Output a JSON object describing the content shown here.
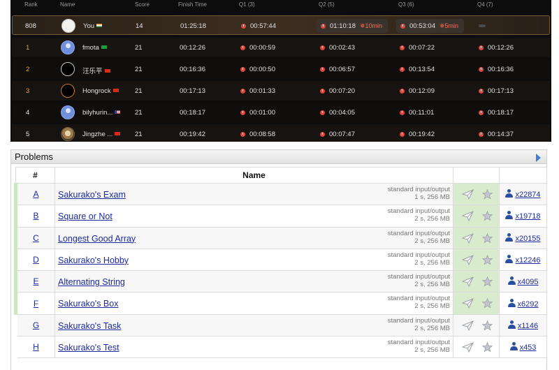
{
  "leaderboard": {
    "headers": {
      "rank": "Rank",
      "name": "Name",
      "score": "Score",
      "finish": "Finish Time",
      "q1": "Q1 (3)",
      "q2": "Q2 (5)",
      "q3": "Q3 (6)",
      "q4": "Q4 (7)"
    },
    "rows": [
      {
        "rank": "808",
        "name": "You",
        "flag": "india-flag",
        "avatar": "default",
        "score": "14",
        "finish": "01:25:18",
        "q1": "00:57:44",
        "q2": "01:10:18",
        "q2_penalty": "10min",
        "q3": "00:53:04",
        "q3_penalty": "5min",
        "q4": ""
      },
      {
        "rank": "1",
        "name": "fmota",
        "flag": "brazil-flag",
        "avatar": "blue",
        "score": "21",
        "finish": "00:12:26",
        "q1": "00:00:59",
        "q2": "00:02:43",
        "q3": "00:07:22",
        "q4": "00:12:26"
      },
      {
        "rank": "2",
        "name": "汪乐平",
        "flag": "china-flag",
        "avatar": "ring",
        "score": "21",
        "finish": "00:16:36",
        "q1": "00:00:50",
        "q2": "00:06:57",
        "q3": "00:13:54",
        "q4": "00:16:36"
      },
      {
        "rank": "3",
        "name": "Hongrock",
        "flag": "china-flag",
        "avatar": "ring-orange",
        "score": "21",
        "finish": "00:17:13",
        "q1": "00:01:33",
        "q2": "00:07:20",
        "q3": "00:12:09",
        "q4": "00:17:13"
      },
      {
        "rank": "4",
        "name": "bilyhurin...",
        "flag": "usa-flag",
        "avatar": "blue",
        "score": "21",
        "finish": "00:18:17",
        "q1": "00:01:00",
        "q2": "00:04:05",
        "q3": "00:11:01",
        "q4": "00:18:17"
      },
      {
        "rank": "5",
        "name": "Jingzhe ...",
        "flag": "china-flag",
        "avatar": "photo",
        "score": "21",
        "finish": "00:19:42",
        "q1": "00:08:58",
        "q2": "00:07:47",
        "q3": "00:19:42",
        "q4": "00:14:37"
      }
    ]
  },
  "problems": {
    "title": "Problems",
    "col_index": "#",
    "col_name": "Name",
    "items": [
      {
        "index": "A",
        "name": "Sakurako's Exam",
        "io": "standard input/output",
        "limits": "1 s, 256 MB",
        "solvers": "x22874",
        "solved": true
      },
      {
        "index": "B",
        "name": "Square or Not",
        "io": "standard input/output",
        "limits": "2 s, 256 MB",
        "solvers": "x19718",
        "solved": true
      },
      {
        "index": "C",
        "name": "Longest Good Array",
        "io": "standard input/output",
        "limits": "2 s, 256 MB",
        "solvers": "x20155",
        "solved": true
      },
      {
        "index": "D",
        "name": "Sakurako's Hobby",
        "io": "standard input/output",
        "limits": "2 s, 256 MB",
        "solvers": "x12246",
        "solved": true
      },
      {
        "index": "E",
        "name": "Alternating String",
        "io": "standard input/output",
        "limits": "2 s, 256 MB",
        "solvers": "x4095",
        "solved": true
      },
      {
        "index": "F",
        "name": "Sakurako's Box",
        "io": "standard input/output",
        "limits": "2 s, 256 MB",
        "solvers": "x6292",
        "solved": true
      },
      {
        "index": "G",
        "name": "Sakurako's Task",
        "io": "standard input/output",
        "limits": "2 s, 256 MB",
        "solvers": "x1146",
        "solved": false
      },
      {
        "index": "H",
        "name": "Sakurako's Test",
        "io": "standard input/output",
        "limits": "2 s, 256 MB",
        "solvers": "x453",
        "solved": false
      }
    ]
  },
  "colors": {
    "solved_bg": "#d8eccd",
    "link": "#1d2c9d",
    "penalty": "#ff6a55",
    "rank_gold": "#e8a23a"
  }
}
